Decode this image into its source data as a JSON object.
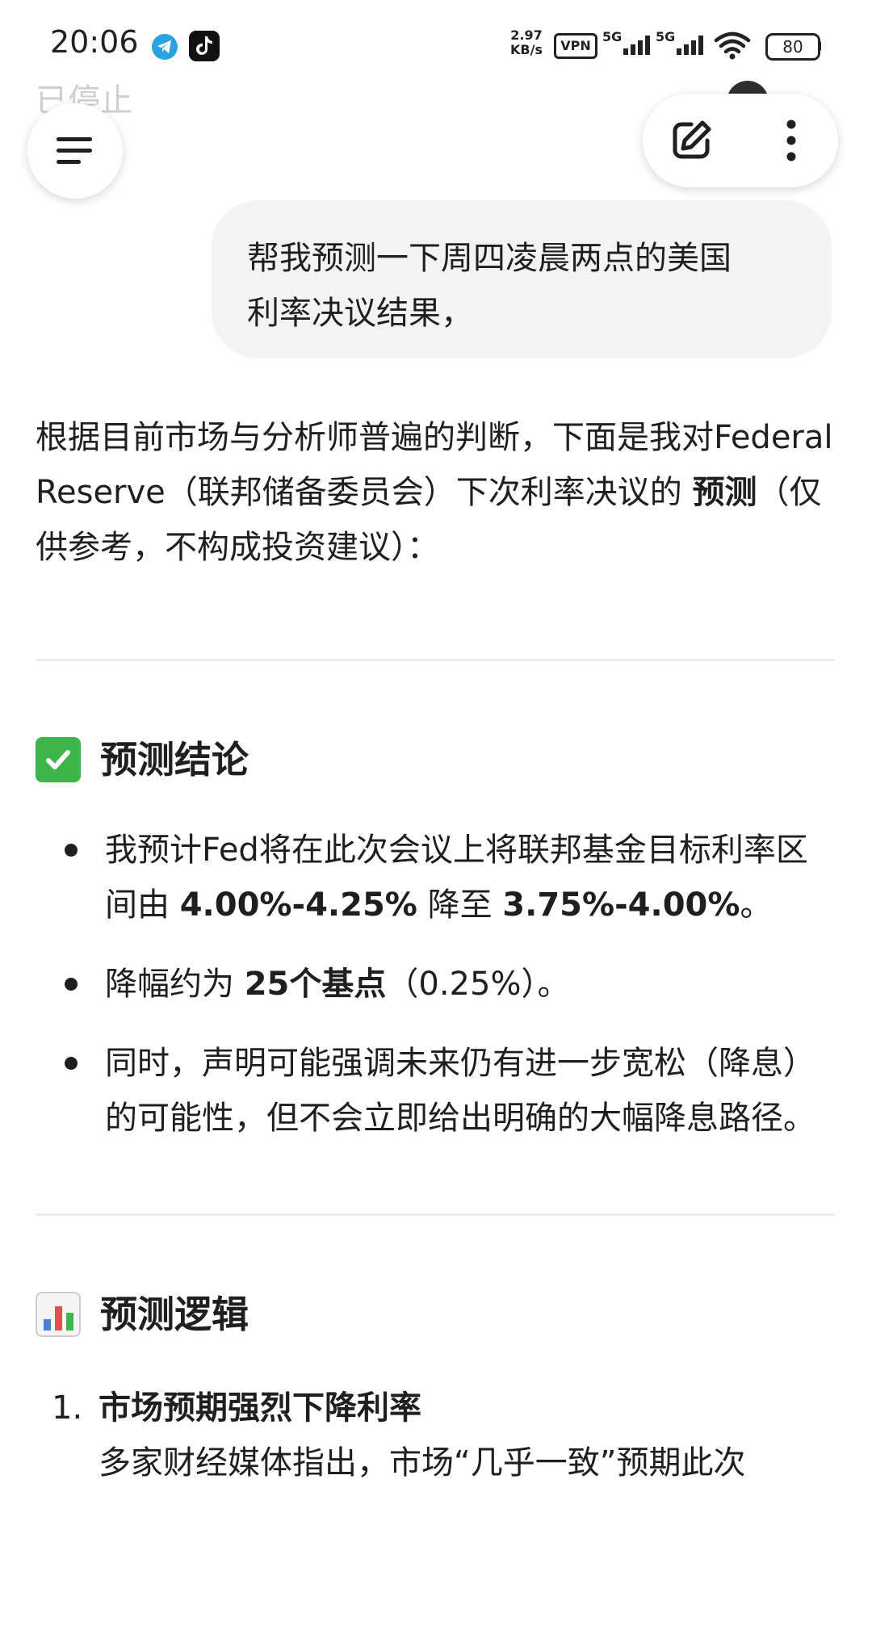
{
  "status_bar": {
    "time": "20:06",
    "net_speed_value": "2.97",
    "net_speed_unit": "KB/s",
    "vpn": "VPN",
    "sim1": "5G",
    "sim2": "5G",
    "battery": "80"
  },
  "header": {
    "stopped_label": "已停止",
    "menu_icon": "hamburger-icon",
    "edit_icon": "edit-icon",
    "more_icon": "more-vertical-icon"
  },
  "user_message": {
    "line1": "帮我预测一下周四凌晨两点的美国",
    "line2": "利率决议结果，"
  },
  "response": {
    "intro_part1": "根据目前市场与分析师普遍的判断，下面是我对Federal Reserve（联邦储备委员会）下次利率决议的 ",
    "intro_bold": "预测",
    "intro_part2": "（仅供参考，不构成投资建议）：",
    "conclusion_heading": "预测结论",
    "bullet1_a": "我预计Fed将在此次会议上将联邦基金目标利率区间由 ",
    "bullet1_b": "4.00%-4.25%",
    "bullet1_c": " 降至 ",
    "bullet1_d": "3.75%-4.00%",
    "bullet1_e": "。",
    "bullet2_a": "降幅约为 ",
    "bullet2_b": "25个基点",
    "bullet2_c": "（0.25%）。",
    "bullet3": "同时，声明可能强调未来仍有进一步宽松（降息）的可能性，但不会立即给出明确的大幅降息路径。",
    "logic_heading": "预测逻辑",
    "logic_item1_num": "1.",
    "logic_item1_title": "市场预期强烈下降利率",
    "logic_item1_text": "多家财经媒体指出，市场“几乎一致”预期此次"
  },
  "colors": {
    "bubble_bg": "#f3f3f3",
    "check_green": "#3db54a",
    "stopped_gray": "#cfcfcf"
  }
}
